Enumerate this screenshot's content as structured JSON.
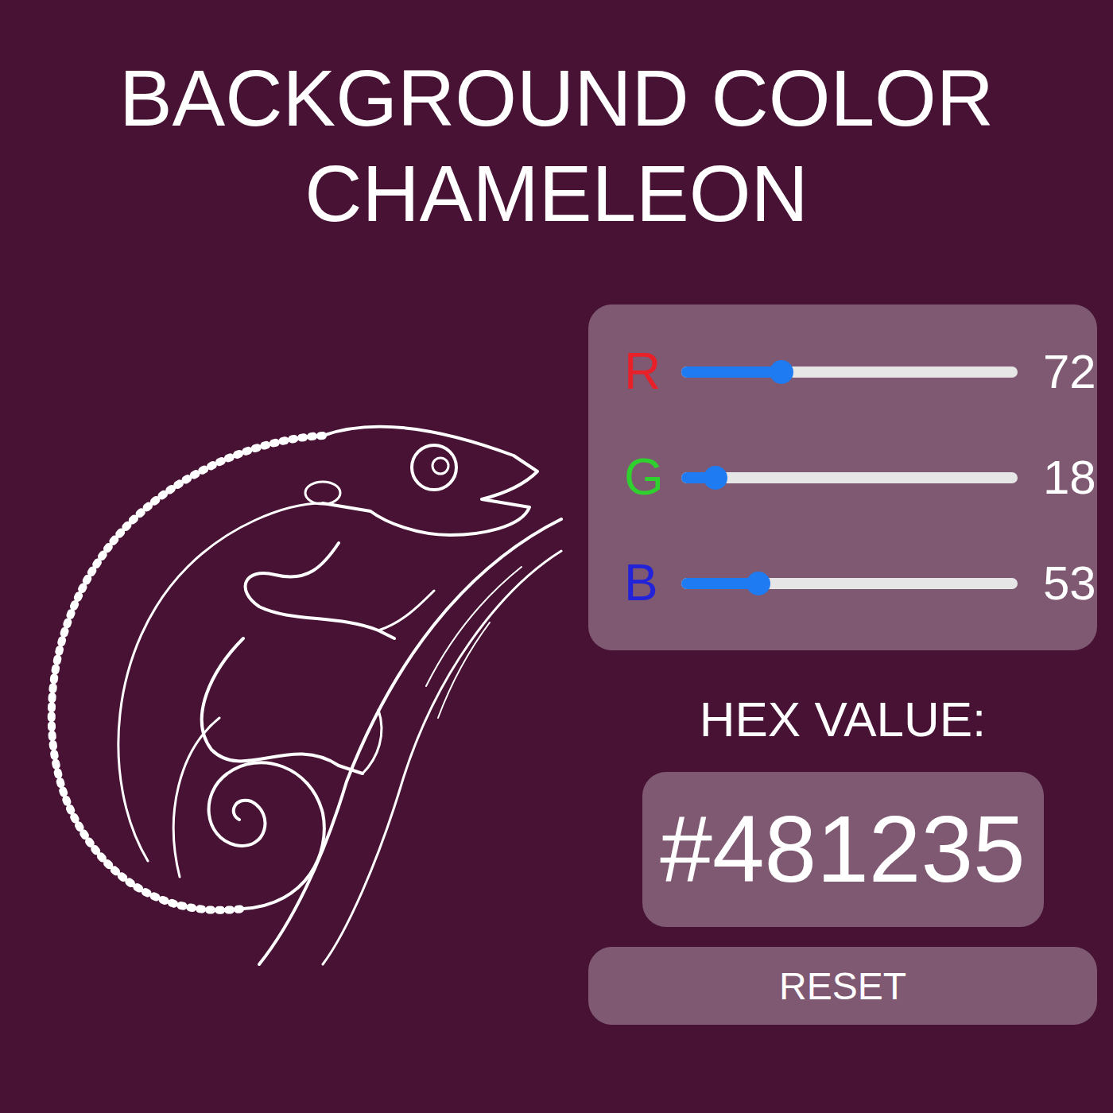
{
  "title": {
    "lines": [
      "BACKGROUND COLOR",
      "CHAMELEON"
    ]
  },
  "sliders": [
    {
      "label": "R",
      "level": 0.282,
      "reading": "72",
      "color": "#e8202a"
    },
    {
      "label": "G",
      "level": 0.071,
      "reading": "18",
      "color": "#2ed12e"
    },
    {
      "label": "B",
      "level": 0.208,
      "reading": "53",
      "color": "#2222d8"
    }
  ],
  "hex": {
    "label": "HEX VALUE:",
    "value": "#481235"
  },
  "buttons": [
    "RESET"
  ]
}
